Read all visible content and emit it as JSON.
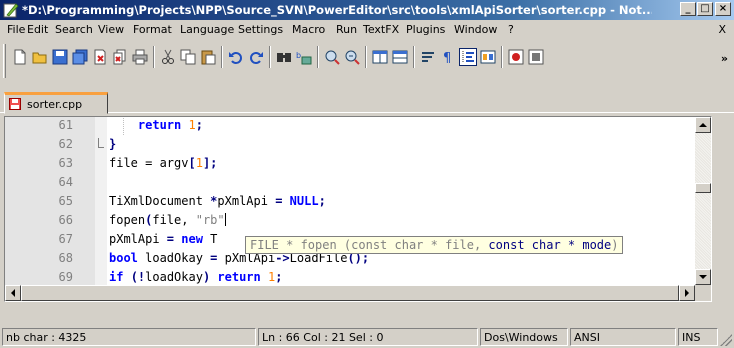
{
  "window": {
    "title": "*D:\\Programming\\Projects\\NPP\\Source_SVN\\PowerEditor\\src\\tools\\xmlApiSorter\\sorter.cpp - Not...",
    "buttons": {
      "minimize": "_",
      "maximize": "□",
      "close": "×"
    }
  },
  "menu": {
    "items": [
      "File",
      "Edit",
      "Search",
      "View",
      "Format",
      "Language",
      "Settings",
      "Macro",
      "Run",
      "TextFX",
      "Plugins",
      "Window",
      "?"
    ],
    "close_label": "X"
  },
  "toolbar": {
    "icons": [
      "new-file-icon",
      "open-file-icon",
      "save-icon",
      "save-all-icon",
      "close-icon",
      "close-all-icon",
      "print-icon",
      "cut-icon",
      "copy-icon",
      "paste-icon",
      "undo-icon",
      "redo-icon",
      "find-icon",
      "replace-icon",
      "zoom-in-icon",
      "zoom-out-icon",
      "sync-vertical-icon",
      "sync-horizontal-icon",
      "word-wrap-icon",
      "show-all-chars-icon",
      "indent-guide-icon",
      "user-lang-icon",
      "record-macro-icon",
      "stop-record-icon"
    ],
    "overflow_label": "»"
  },
  "tabs": [
    {
      "label": "sorter.cpp",
      "active": true,
      "modified": true
    }
  ],
  "editor": {
    "lines": [
      {
        "number": "61",
        "tokens": [
          {
            "t": "    ",
            "c": ""
          },
          {
            "t": "return",
            "c": "kw"
          },
          {
            "t": " ",
            "c": ""
          },
          {
            "t": "1",
            "c": "num"
          },
          {
            "t": ";",
            "c": "op"
          }
        ]
      },
      {
        "number": "62",
        "tokens": [
          {
            "t": "}",
            "c": "op"
          }
        ]
      },
      {
        "number": "63",
        "tokens": [
          {
            "t": "file = argv",
            "c": ""
          },
          {
            "t": "[",
            "c": "op"
          },
          {
            "t": "1",
            "c": "num"
          },
          {
            "t": "];",
            "c": "op"
          }
        ]
      },
      {
        "number": "64",
        "tokens": []
      },
      {
        "number": "65",
        "tokens": [
          {
            "t": "TiXmlDocument ",
            "c": ""
          },
          {
            "t": "*",
            "c": "op"
          },
          {
            "t": "pXmlApi ",
            "c": ""
          },
          {
            "t": "=",
            "c": "op"
          },
          {
            "t": " ",
            "c": ""
          },
          {
            "t": "NULL",
            "c": "kw"
          },
          {
            "t": ";",
            "c": "op"
          }
        ]
      },
      {
        "number": "66",
        "tokens": [
          {
            "t": "fopen",
            "c": ""
          },
          {
            "t": "(",
            "c": "op"
          },
          {
            "t": "file, ",
            "c": ""
          },
          {
            "t": "\"rb\"",
            "c": "str"
          }
        ]
      },
      {
        "number": "67",
        "tokens": [
          {
            "t": "pXmlApi ",
            "c": ""
          },
          {
            "t": "=",
            "c": "op"
          },
          {
            "t": " ",
            "c": ""
          },
          {
            "t": "new",
            "c": "kw"
          },
          {
            "t": " T",
            "c": ""
          }
        ]
      },
      {
        "number": "68",
        "tokens": [
          {
            "t": "bool",
            "c": "kw"
          },
          {
            "t": " loadOkay ",
            "c": ""
          },
          {
            "t": "=",
            "c": "op"
          },
          {
            "t": " pXmlApi",
            "c": ""
          },
          {
            "t": "->",
            "c": "op"
          },
          {
            "t": "LoadFile",
            "c": ""
          },
          {
            "t": "();",
            "c": "op"
          }
        ]
      },
      {
        "number": "69",
        "tokens": [
          {
            "t": "if",
            "c": "kw"
          },
          {
            "t": " ",
            "c": ""
          },
          {
            "t": "(!",
            "c": "op"
          },
          {
            "t": "loadOkay",
            "c": ""
          },
          {
            "t": ")",
            "c": "op"
          },
          {
            "t": " ",
            "c": ""
          },
          {
            "t": "return",
            "c": "kw"
          },
          {
            "t": " ",
            "c": ""
          },
          {
            "t": "1",
            "c": "num"
          },
          {
            "t": ";",
            "c": "op"
          }
        ]
      }
    ],
    "calltip": {
      "before": "FILE * fopen (const char * file, ",
      "highlight": "const char * mode",
      "after": ")"
    }
  },
  "status": {
    "char_count": "nb char : 4325",
    "position": "Ln : 66   Col : 21   Sel : 0",
    "eol": "Dos\\Windows",
    "encoding": "ANSI",
    "mode": "INS"
  },
  "colors": {
    "keyword": "#0000ff",
    "number": "#ff8000",
    "string": "#808080",
    "operator": "#000080",
    "calltip_bg": "#ffffe1",
    "tab_accent": "#f9a03f"
  }
}
